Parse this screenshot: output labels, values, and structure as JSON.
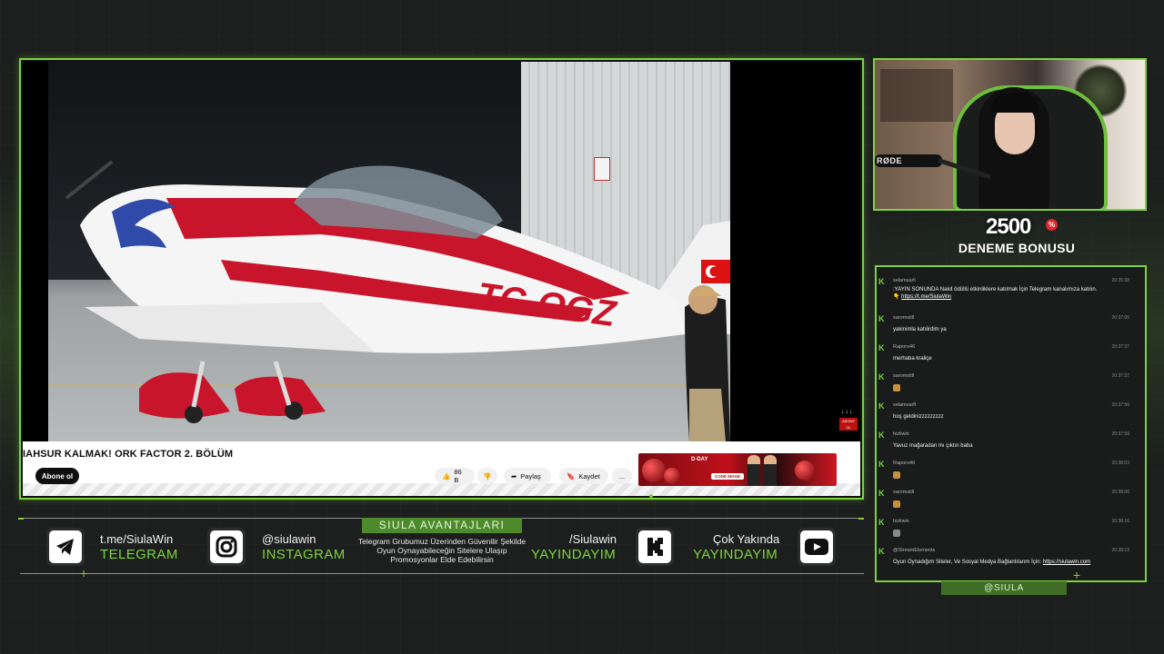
{
  "video": {
    "title": "IAHSUR KALMAK! ORK FACTOR 2. BÖLÜM",
    "tail_number": "TC-OGZ",
    "subscribe_label": "Abone ol",
    "like_count": "86 B",
    "share_label": "Paylaş",
    "save_label": "Kaydet",
    "more_label": "...",
    "corner_badge": "ABONE OL",
    "ad": {
      "brand": "D-DAY",
      "button": "CODE MOGE"
    }
  },
  "webcam": {
    "mic_label": "RØDE"
  },
  "bonus": {
    "amount": "2500",
    "percent": "%",
    "label": "DENEME BONUSU"
  },
  "chat": {
    "messages": [
      {
        "user": "selamsarll",
        "time": "20:26:38",
        "text": ":YAYIN SONUNDA Nakit ödüllü etkinliklere katılmak İçin Telegram kanalımıza katılın.",
        "link": "https://t.me/SiulaWin",
        "emoji": "👇"
      },
      {
        "user": "saromstill",
        "time": "20:37:05",
        "text": "yakinimla katılirdim ya"
      },
      {
        "user": "Raporo46",
        "time": "20:37:37",
        "text": "merhaba kraliçe"
      },
      {
        "user": "saromstill",
        "time": "20:37:37",
        "text": ""
      },
      {
        "user": "selamvarfl",
        "time": "20:37:56",
        "text": "hoş geldinizzzzzzzzz"
      },
      {
        "user": "hizliwin",
        "time": "20:37:59",
        "text": "Yavuz mağaradan mı çıktın baba"
      },
      {
        "user": "Raporo46",
        "time": "20:38:03",
        "text": ""
      },
      {
        "user": "saromstill",
        "time": "20:38:06",
        "text": ""
      },
      {
        "user": "hizliwin",
        "time": "20:38:16",
        "text": ""
      },
      {
        "user": "@StreamElements",
        "time": "20:38:19",
        "text": "Oyun Oynadığım Siteler, Ve Sosyal Medya Bağlantılarım İçin:",
        "link": "https://siulawin.com"
      }
    ]
  },
  "siula_tag": "@SIULA",
  "social": {
    "telegram": {
      "handle": "t.me/SiulaWin",
      "name": "TELEGRAM"
    },
    "instagram": {
      "handle": "@siulawin",
      "name": "INSTAGRAM"
    },
    "promo": {
      "title": "SIULA AVANTAJLARI",
      "text": "Telegram Grubumuz Üzerinden Güvenilir Şekilde Oyun Oynayabileceğin Sitelere Ulaşıp Promosyonlar Elde Edebilirsin"
    },
    "kick": {
      "handle": "/Siulawin",
      "name": "YAYINDAYIM"
    },
    "youtube": {
      "handle": "Çok Yakında",
      "name": "YAYINDAYIM"
    }
  },
  "colors": {
    "accent": "#7dd33f",
    "background": "#1c1f1e",
    "ad_red": "#c0101a"
  },
  "icons": [
    "telegram-icon",
    "instagram-icon",
    "kick-icon",
    "youtube-icon",
    "like-icon",
    "dislike-icon",
    "share-icon",
    "bookmark-icon"
  ]
}
